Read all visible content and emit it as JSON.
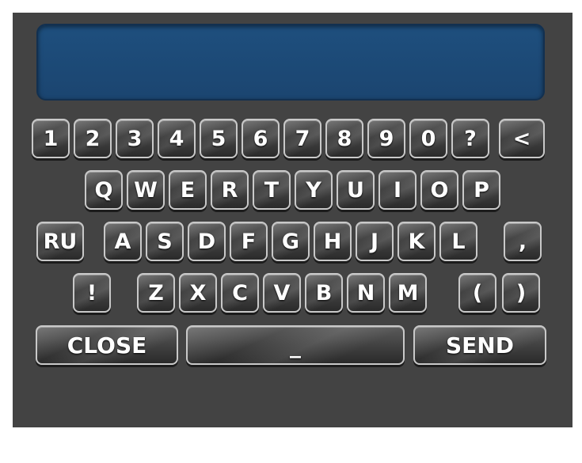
{
  "display": {
    "text": ""
  },
  "rows": {
    "numbers": [
      "1",
      "2",
      "3",
      "4",
      "5",
      "6",
      "7",
      "8",
      "9",
      "0",
      "?",
      "<"
    ],
    "qwerty": [
      "Q",
      "W",
      "E",
      "R",
      "T",
      "Y",
      "U",
      "I",
      "O",
      "P"
    ],
    "asdf": [
      "RU",
      "A",
      "S",
      "D",
      "F",
      "G",
      "H",
      "J",
      "K",
      "L",
      ","
    ],
    "zxcv": [
      "!",
      "Z",
      "X",
      "C",
      "V",
      "B",
      "N",
      "M",
      "(",
      ")"
    ]
  },
  "bottom": {
    "close_label": "CLOSE",
    "space_label": "_",
    "send_label": "SEND"
  },
  "colors": {
    "panel": "#434343",
    "display": "#1e4f7e",
    "key_text": "#ffffff"
  }
}
